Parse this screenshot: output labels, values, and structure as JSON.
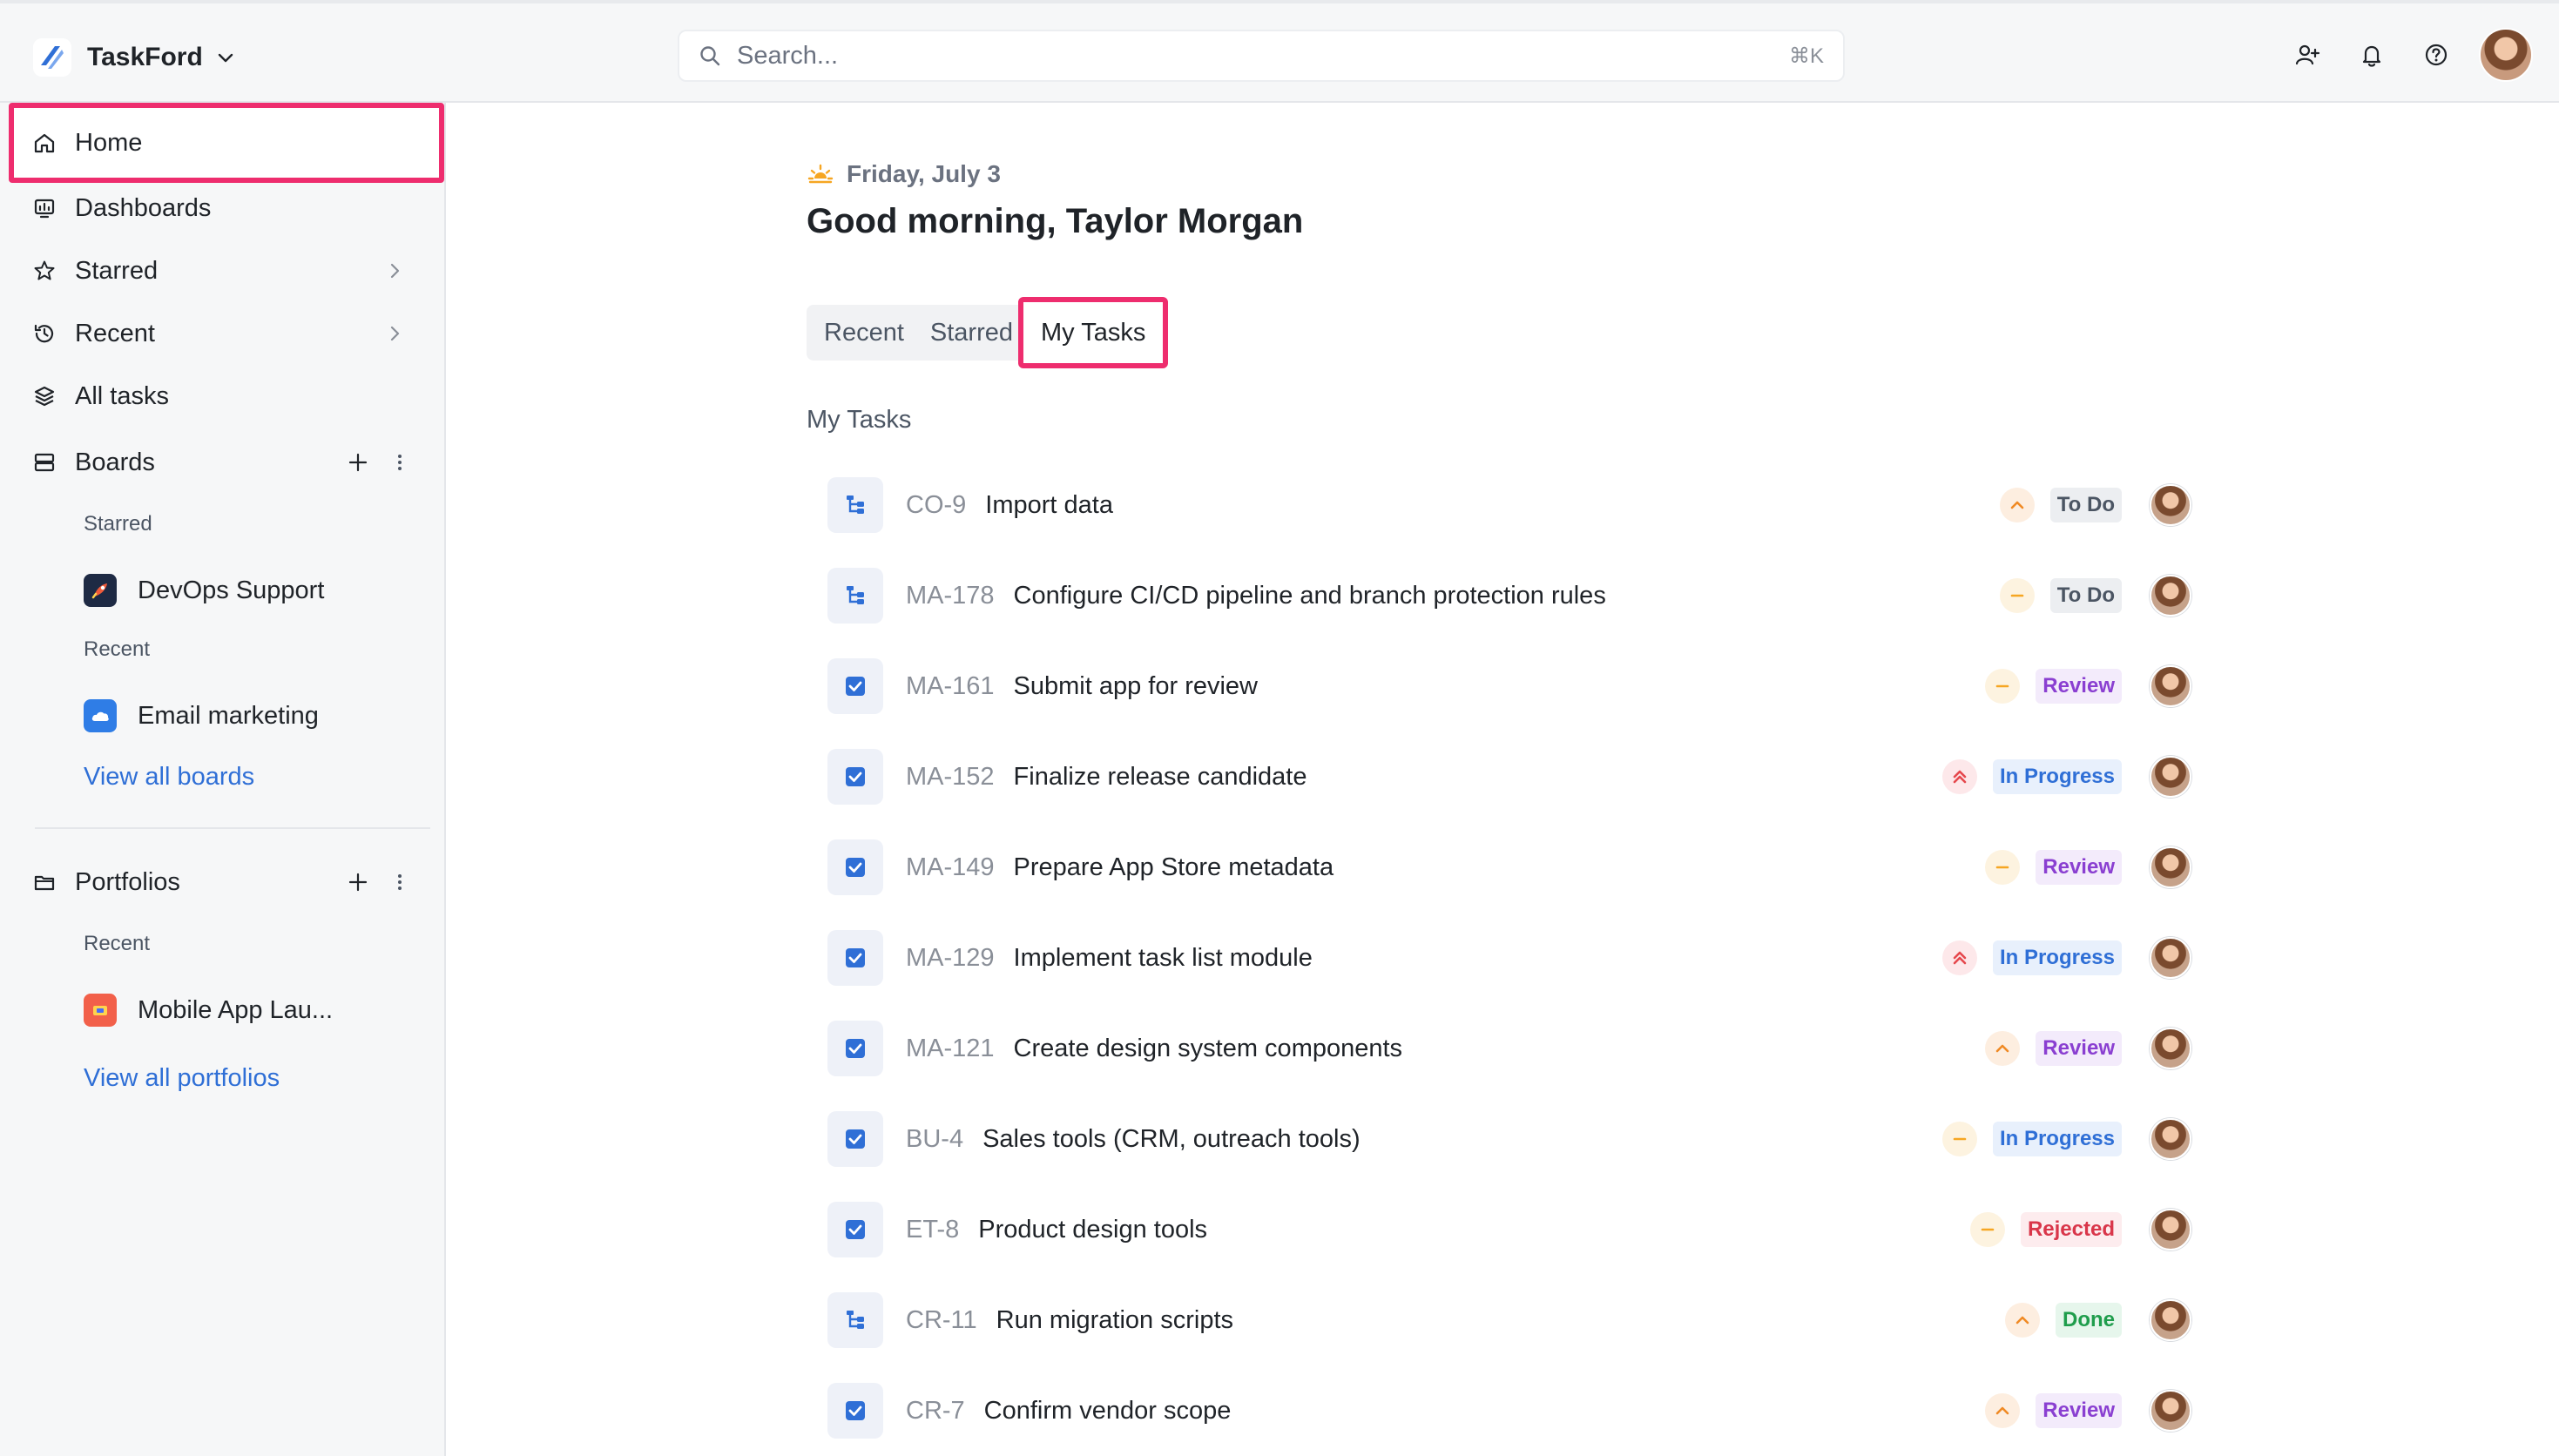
{
  "app": {
    "name": "TaskFord",
    "search_placeholder": "Search...",
    "search_shortcut": "⌘K"
  },
  "sidebar": {
    "items": [
      {
        "label": "Home",
        "icon": "home-icon"
      },
      {
        "label": "Dashboards",
        "icon": "dashboard-icon"
      },
      {
        "label": "Starred",
        "icon": "star-icon"
      },
      {
        "label": "Recent",
        "icon": "history-icon"
      },
      {
        "label": "All tasks",
        "icon": "layers-icon"
      }
    ],
    "boards": {
      "label": "Boards",
      "starred_heading": "Starred",
      "starred": [
        {
          "label": "DevOps Support",
          "icon": "rocket-icon"
        }
      ],
      "recent_heading": "Recent",
      "recent": [
        {
          "label": "Email marketing",
          "icon": "cloud-icon"
        }
      ],
      "view_all": "View all boards"
    },
    "portfolios": {
      "label": "Portfolios",
      "recent_heading": "Recent",
      "recent": [
        {
          "label": "Mobile App Lau...",
          "icon": "portfolio-icon"
        }
      ],
      "view_all": "View all portfolios"
    }
  },
  "main": {
    "date": "Friday, July 3",
    "greeting": "Good morning, Taylor Morgan",
    "tabs": [
      {
        "label": "Recent",
        "active": false
      },
      {
        "label": "Starred",
        "active": false
      },
      {
        "label": "My Tasks",
        "active": true
      }
    ],
    "section_title": "My Tasks",
    "tasks": [
      {
        "key": "CO-9",
        "title": "Import data",
        "type": "subtask-icon",
        "priority": "medium-high",
        "status": "To Do"
      },
      {
        "key": "MA-178",
        "title": "Configure CI/CD pipeline and branch protection rules",
        "type": "subtask-icon",
        "priority": "medium",
        "status": "To Do"
      },
      {
        "key": "MA-161",
        "title": "Submit app for review",
        "type": "task-checkbox-icon",
        "priority": "medium",
        "status": "Review"
      },
      {
        "key": "MA-152",
        "title": "Finalize release candidate",
        "type": "task-checkbox-icon",
        "priority": "highest",
        "status": "In Progress"
      },
      {
        "key": "MA-149",
        "title": "Prepare App Store metadata",
        "type": "task-checkbox-icon",
        "priority": "medium",
        "status": "Review"
      },
      {
        "key": "MA-129",
        "title": "Implement task list module",
        "type": "task-checkbox-icon",
        "priority": "highest",
        "status": "In Progress"
      },
      {
        "key": "MA-121",
        "title": "Create design system components",
        "type": "task-checkbox-icon",
        "priority": "medium-high",
        "status": "Review"
      },
      {
        "key": "BU-4",
        "title": "Sales tools (CRM, outreach tools)",
        "type": "task-checkbox-icon",
        "priority": "medium",
        "status": "In Progress"
      },
      {
        "key": "ET-8",
        "title": "Product design tools",
        "type": "task-checkbox-icon",
        "priority": "medium",
        "status": "Rejected"
      },
      {
        "key": "CR-11",
        "title": "Run migration scripts",
        "type": "subtask-icon",
        "priority": "medium-high",
        "status": "Done"
      },
      {
        "key": "CR-7",
        "title": "Confirm vendor scope",
        "type": "task-checkbox-icon",
        "priority": "medium-high",
        "status": "Review"
      }
    ]
  },
  "colors": {
    "highlight": "#ee2d6e",
    "link": "#2f6fd6",
    "status_todo": "#4b5563",
    "status_review": "#8a3fd1",
    "status_in_progress": "#2f6fd6",
    "status_rejected": "#d9364a",
    "status_done": "#1f9d4c"
  }
}
